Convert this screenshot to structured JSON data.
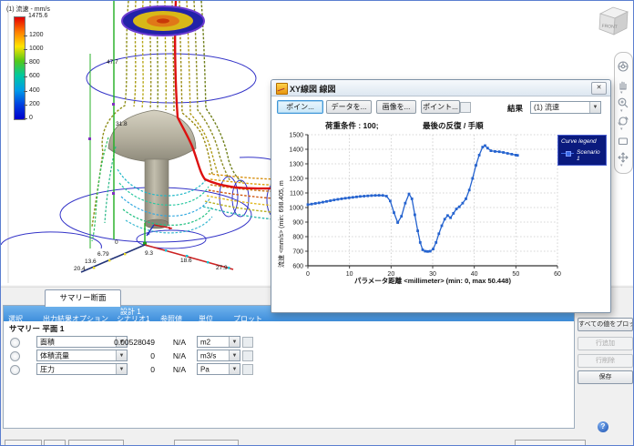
{
  "icons": {
    "close": "✕",
    "help": "?",
    "dropdown_arrow": "▼",
    "checkbox": "",
    "radio": ""
  },
  "colorbar": {
    "title": "(1) 流速 - mm/s",
    "max_label": "1475.6",
    "max_value": 1475.6,
    "ticks": [
      "1200",
      "1000",
      "800",
      "600",
      "400",
      "200",
      "0"
    ],
    "colors": [
      "#e40000",
      "#ff7d00",
      "#ffe400",
      "#54c818",
      "#00c8a0",
      "#009ce8",
      "#0040e0",
      "#0000cc"
    ]
  },
  "viewport": {
    "green_axis_labels": [
      "47.7",
      "31.8"
    ],
    "red_axis_labels": [
      "0",
      "9.3",
      "18.6",
      "27.9"
    ],
    "navy_axis_labels": [
      "6.79",
      "13.6",
      "20.4"
    ]
  },
  "viewcube": {
    "front_label": "FRONT"
  },
  "nav_toolbar": {
    "icons": [
      "steering-wheel",
      "pan-hand",
      "zoom-magnifier",
      "orbit",
      "look-at",
      "full-navigation"
    ]
  },
  "xy_window": {
    "title": "XY線図  線図",
    "toolbar_buttons": [
      "ポイン...",
      "データを...",
      "画像を...",
      "ポイント..."
    ],
    "toolbar_checkbox_checked": false,
    "quantity_label": "結果",
    "quantity_value": "(1) 流速",
    "condition_text": "荷重条件 : 100;",
    "condition_text2": "最後の反復  / 手順"
  },
  "chart_data": {
    "type": "line",
    "title": "",
    "xlabel": "パラメータ距離 <millimeter> (min: 0, max 50.448)",
    "ylabel": "流速 <mm/s> (min: 698.405, m",
    "xlim": [
      0,
      60
    ],
    "ylim": [
      600,
      1500
    ],
    "xticks": [
      0,
      10,
      20,
      30,
      40,
      50,
      60
    ],
    "yticks": [
      600,
      700,
      800,
      900,
      1000,
      1100,
      1200,
      1300,
      1400,
      1500
    ],
    "grid": true,
    "legend_title": "Curve legend",
    "legend_position": "top-right",
    "series": [
      {
        "name": "Scenario 1",
        "color": "#2563cf",
        "marker": "square",
        "x": [
          0,
          0.9,
          1.8,
          2.7,
          3.6,
          4.5,
          5.4,
          6.3,
          7.2,
          8.1,
          9,
          9.9,
          10.8,
          11.7,
          12.6,
          13.5,
          14.4,
          15.3,
          16.2,
          17.1,
          18,
          18.9,
          19.8,
          20.7,
          21.6,
          22.5,
          23.4,
          24.3,
          25,
          25.7,
          26.4,
          27,
          27.6,
          28.2,
          28.8,
          29.4,
          30.1,
          30.8,
          31.5,
          32.2,
          32.9,
          33.6,
          34.3,
          35,
          35.7,
          36.4,
          37.2,
          38,
          38.8,
          39.6,
          40.4,
          41.2,
          42,
          42.6,
          43.2,
          44,
          45,
          46,
          47,
          48,
          49,
          50,
          50.4
        ],
        "y": [
          1020,
          1024,
          1028,
          1032,
          1037,
          1042,
          1047,
          1052,
          1056,
          1060,
          1064,
          1067,
          1070,
          1073,
          1076,
          1078,
          1080,
          1082,
          1083,
          1084,
          1083,
          1078,
          1045,
          965,
          897,
          940,
          1030,
          1093,
          1060,
          950,
          840,
          760,
          710,
          700,
          698,
          700,
          715,
          760,
          820,
          875,
          920,
          945,
          930,
          960,
          990,
          1005,
          1030,
          1060,
          1120,
          1200,
          1290,
          1360,
          1415,
          1425,
          1408,
          1390,
          1385,
          1383,
          1378,
          1372,
          1366,
          1360,
          1358
        ]
      }
    ]
  },
  "summary_panel": {
    "tab_label": "サマリー断面",
    "columns": {
      "select": "選択",
      "output_option": "出力結果オプション",
      "design": "設計 1",
      "scenario": "シナリオ1",
      "reference": "参照値",
      "unit": "単位",
      "plot": "プロット"
    },
    "group_label": "サマリー 平面 1",
    "rows": [
      {
        "option": "面積",
        "value": "0.00528049",
        "reference": "N/A",
        "unit": "m2",
        "plot_checked": false
      },
      {
        "option": "体積流量",
        "value": "0",
        "reference": "N/A",
        "unit": "m3/s",
        "plot_checked": false
      },
      {
        "option": "圧力",
        "value": "0",
        "reference": "N/A",
        "unit": "Pa",
        "plot_checked": false
      }
    ],
    "side_buttons": [
      {
        "label": "すべての値をプロット",
        "enabled": true
      },
      {
        "label": "行追加",
        "enabled": false
      },
      {
        "label": "行削除",
        "enabled": false
      },
      {
        "label": "保存",
        "enabled": true
      }
    ]
  }
}
